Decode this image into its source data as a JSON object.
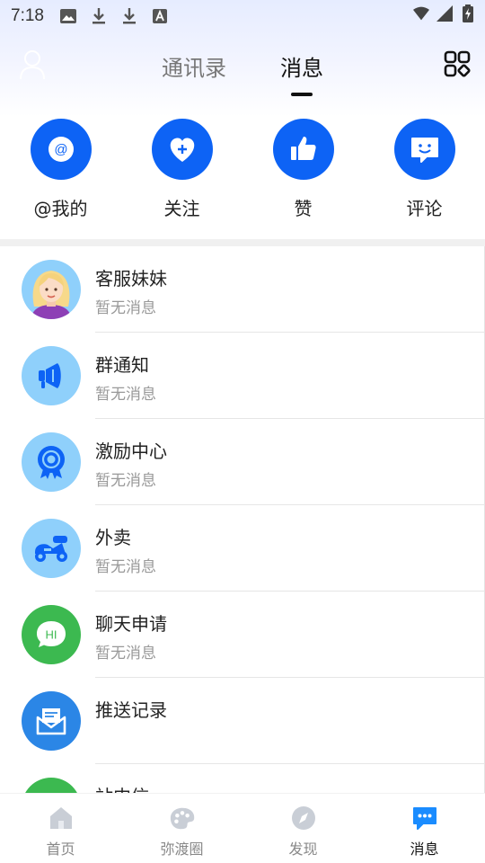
{
  "status_bar": {
    "time": "7:18",
    "left_icons": [
      "image-icon",
      "download-icon",
      "download-icon",
      "a-box-icon"
    ],
    "right_icons": [
      "wifi-icon",
      "signal-icon",
      "battery-icon"
    ]
  },
  "header": {
    "tabs": [
      {
        "label": "通讯录",
        "active": false
      },
      {
        "label": "消息",
        "active": true
      }
    ],
    "avatar_icon": "user-outline-icon",
    "apps_icon": "grid-apps-icon"
  },
  "quick_actions": [
    {
      "label": "@我的",
      "icon": "at-icon"
    },
    {
      "label": "关注",
      "icon": "heart-plus-icon"
    },
    {
      "label": "赞",
      "icon": "thumbs-up-icon"
    },
    {
      "label": "评论",
      "icon": "comment-smile-icon"
    }
  ],
  "messages": [
    {
      "title": "客服妹妹",
      "subtitle": "暂无消息",
      "icon": "customer-service-girl-icon"
    },
    {
      "title": "群通知",
      "subtitle": "暂无消息",
      "icon": "megaphone-icon"
    },
    {
      "title": "激励中心",
      "subtitle": "暂无消息",
      "icon": "medal-icon"
    },
    {
      "title": "外卖",
      "subtitle": "暂无消息",
      "icon": "scooter-icon"
    },
    {
      "title": "聊天申请",
      "subtitle": "暂无消息",
      "icon": "hi-bubble-icon"
    },
    {
      "title": "推送记录",
      "subtitle": "",
      "icon": "mail-icon"
    },
    {
      "title": "站内信",
      "subtitle": "",
      "icon": "inbox-icon"
    }
  ],
  "bottom_nav": [
    {
      "label": "首页",
      "icon": "home-icon",
      "active": false
    },
    {
      "label": "弥渡圈",
      "icon": "palette-icon",
      "active": false
    },
    {
      "label": "发现",
      "icon": "compass-icon",
      "active": false
    },
    {
      "label": "消息",
      "icon": "chat-bubble-icon",
      "active": true
    }
  ],
  "colors": {
    "accent": "#0d63f5",
    "light_blue": "#8fd0fb",
    "green": "#3cb950",
    "push_blue": "#2b86e6"
  }
}
